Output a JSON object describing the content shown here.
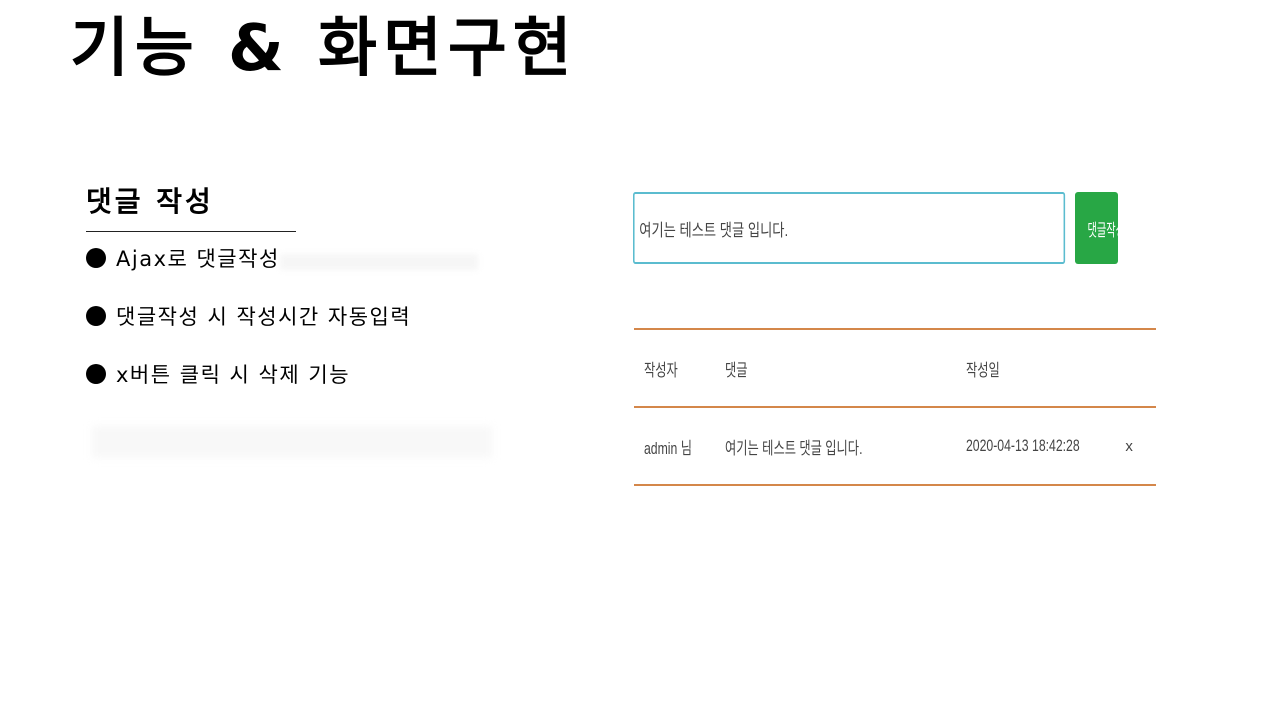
{
  "slide": {
    "title": "기능 & 화면구현"
  },
  "section": {
    "title": "댓글 작성",
    "bullets": [
      "Ajax로 댓글작성",
      "댓글작성 시 작성시간 자동입력",
      "x버튼 클릭 시 삭제 기능"
    ]
  },
  "comment_form": {
    "input_value": "여기는 테스트 댓글 입니다.",
    "submit_label": "댓글작성",
    "accent_color": "#28a745",
    "input_border_color": "#5bbccf"
  },
  "comments_table": {
    "headers": {
      "author": "작성자",
      "comment": "댓글",
      "date": "작성일"
    },
    "rows": [
      {
        "author": "admin 님",
        "comment": "여기는 테스트 댓글 입니다.",
        "date": "2020-04-13 18:42:28",
        "delete_label": "x"
      }
    ],
    "rule_color": "#d4874a"
  }
}
